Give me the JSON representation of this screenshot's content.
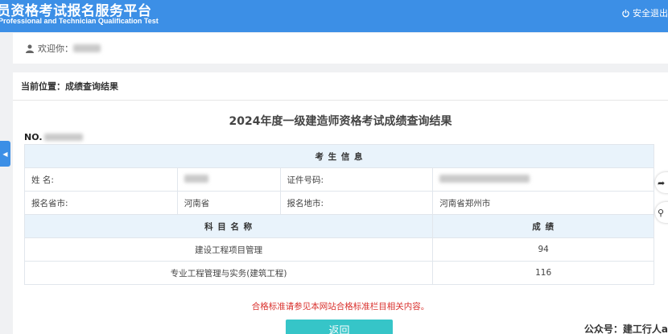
{
  "header": {
    "title": "员资格考试报名服务平台",
    "subtitle": "Professional and Technician Qualification Test",
    "logout_label": "安全退出"
  },
  "welcome": {
    "label": "欢迎你："
  },
  "breadcrumb": {
    "text": "当前位置：成绩查询结果"
  },
  "page": {
    "title": "2024年度一级建造师资格考试成绩查询结果",
    "cert_no_prefix": "NO."
  },
  "info": {
    "section_header": "考  生  信  息",
    "name_label": "姓      名:",
    "id_label": "证件号码:",
    "province_label": "报名省市:",
    "province_value": "河南省",
    "city_label": "报名地市:",
    "city_value": "河南省郑州市"
  },
  "scores": {
    "subject_header": "科  目  名  称",
    "score_header": "成  绩",
    "rows": [
      {
        "subject": "建设工程项目管理",
        "score": "94"
      },
      {
        "subject": "专业工程管理与实务(建筑工程)",
        "score": "116"
      }
    ]
  },
  "note": "合格标准请参见本网站合格标准栏目相关内容。",
  "return_label": "返回",
  "watermark": "公众号：建工行人a",
  "colors": {
    "header_bg": "#3c8fe6",
    "table_head_bg": "#e9f3fb",
    "button_bg": "#36c5c8",
    "note_red": "#d9302c"
  }
}
